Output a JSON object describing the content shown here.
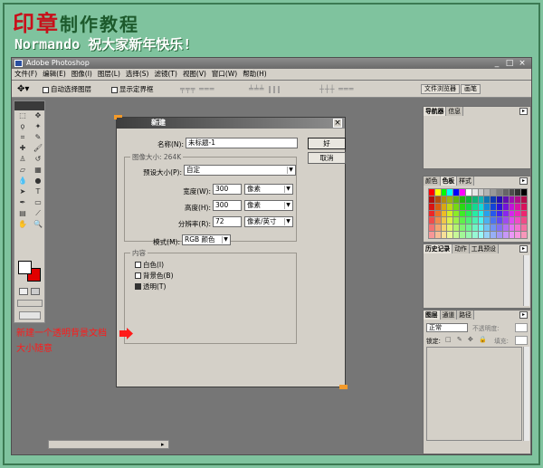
{
  "header": {
    "title_red": "印章",
    "title_rest": "制作教程",
    "subtitle": "Normando 祝大家新年快乐!"
  },
  "app": {
    "title": "Adobe Photoshop",
    "window_buttons": [
      "_",
      "□",
      "×"
    ],
    "menu": [
      "文件(F)",
      "编辑(E)",
      "图像(I)",
      "图层(L)",
      "选择(S)",
      "滤镜(T)",
      "视图(V)",
      "窗口(W)",
      "帮助(H)"
    ],
    "options": {
      "auto_select": "自动选择图层",
      "show_bounds": "显示定界框",
      "browser_tab": "文件浏览器",
      "brush_tab": "画笔"
    }
  },
  "panels": {
    "navigator": [
      "导航器",
      "信息"
    ],
    "swatches": [
      "颜色",
      "色板",
      "样式"
    ],
    "history": [
      "历史记录",
      "动作",
      "工具预设"
    ],
    "layers": {
      "tabs": [
        "图层",
        "通道",
        "路径"
      ],
      "blend_mode": "正常",
      "opacity_label": "不透明度:",
      "lock_label": "锁定:",
      "fill_label": "填充:"
    }
  },
  "dialog": {
    "title": "新建",
    "name_label": "名称(N):",
    "name_value": "未标题-1",
    "ok": "好",
    "cancel": "取消",
    "size_group": "图像大小: 264K",
    "preset_label": "预设大小(P):",
    "preset_value": "自定",
    "width_label": "宽度(W):",
    "width_value": "300",
    "width_unit": "像素",
    "height_label": "高度(H):",
    "height_value": "300",
    "height_unit": "像素",
    "res_label": "分辨率(R):",
    "res_value": "72",
    "res_unit": "像素/英寸",
    "mode_label": "模式(M):",
    "mode_value": "RGB 颜色",
    "content_group": "内容",
    "content_options": [
      {
        "label": "白色(I)",
        "checked": false
      },
      {
        "label": "背景色(B)",
        "checked": false
      },
      {
        "label": "透明(T)",
        "checked": true
      }
    ]
  },
  "annotation": {
    "line1": "新建一个透明背景文档",
    "line2": "大小随意"
  },
  "colors": {
    "background": "#7fc39e",
    "accent_red": "#ff1a1a",
    "title_green": "#1d5a2c"
  }
}
